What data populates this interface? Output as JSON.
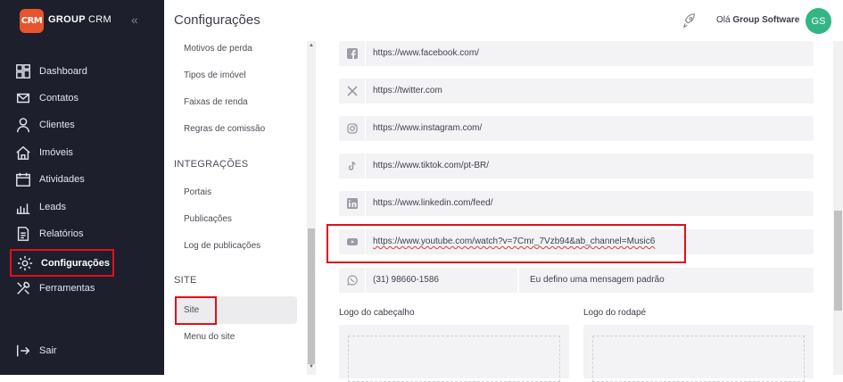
{
  "brand": {
    "logo_text": "CRM",
    "name_bold": "GROUP",
    "name_thin": "CRM"
  },
  "nav": {
    "items": [
      {
        "label": "Dashboard"
      },
      {
        "label": "Contatos"
      },
      {
        "label": "Clientes"
      },
      {
        "label": "Imóveis"
      },
      {
        "label": "Atividades"
      },
      {
        "label": "Leads"
      },
      {
        "label": "Relatórios"
      },
      {
        "label": "Configurações"
      },
      {
        "label": "Ferramentas"
      }
    ],
    "logout": "Sair"
  },
  "header": {
    "title": "Configurações",
    "greeting": "Olá",
    "user": "Group Software",
    "avatar": "GS"
  },
  "submenu": {
    "items_top": [
      "Motivos de perda",
      "Tipos de imóvel",
      "Faixas de renda",
      "Regras de comissão"
    ],
    "section_integracoes": "INTEGRAÇÕES",
    "items_integracoes": [
      "Portais",
      "Publicações",
      "Log de publicações"
    ],
    "section_site": "SITE",
    "items_site": [
      "Site",
      "Menu do site"
    ]
  },
  "social": {
    "facebook": "https://www.facebook.com/",
    "twitter": "https://twitter.com",
    "instagram": "https://www.instagram.com/",
    "tiktok": "https://www.tiktok.com/pt-BR/",
    "linkedin": "https://www.linkedin.com/feed/",
    "youtube": "https://www.youtube.com/watch?v=7Cmr_7Vzb94&ab_channel=Music6",
    "whatsapp": "(31) 98660-1586",
    "whatsapp_message": "Eu defino uma mensagem padrão"
  },
  "uploads": {
    "header_logo": "Logo do cabeçalho",
    "footer_logo": "Logo do rodapé"
  },
  "colors": {
    "sidebar": "#1d1f2c",
    "highlight": "#e0101a",
    "avatar": "#32b681",
    "logo": "#e8542b"
  }
}
